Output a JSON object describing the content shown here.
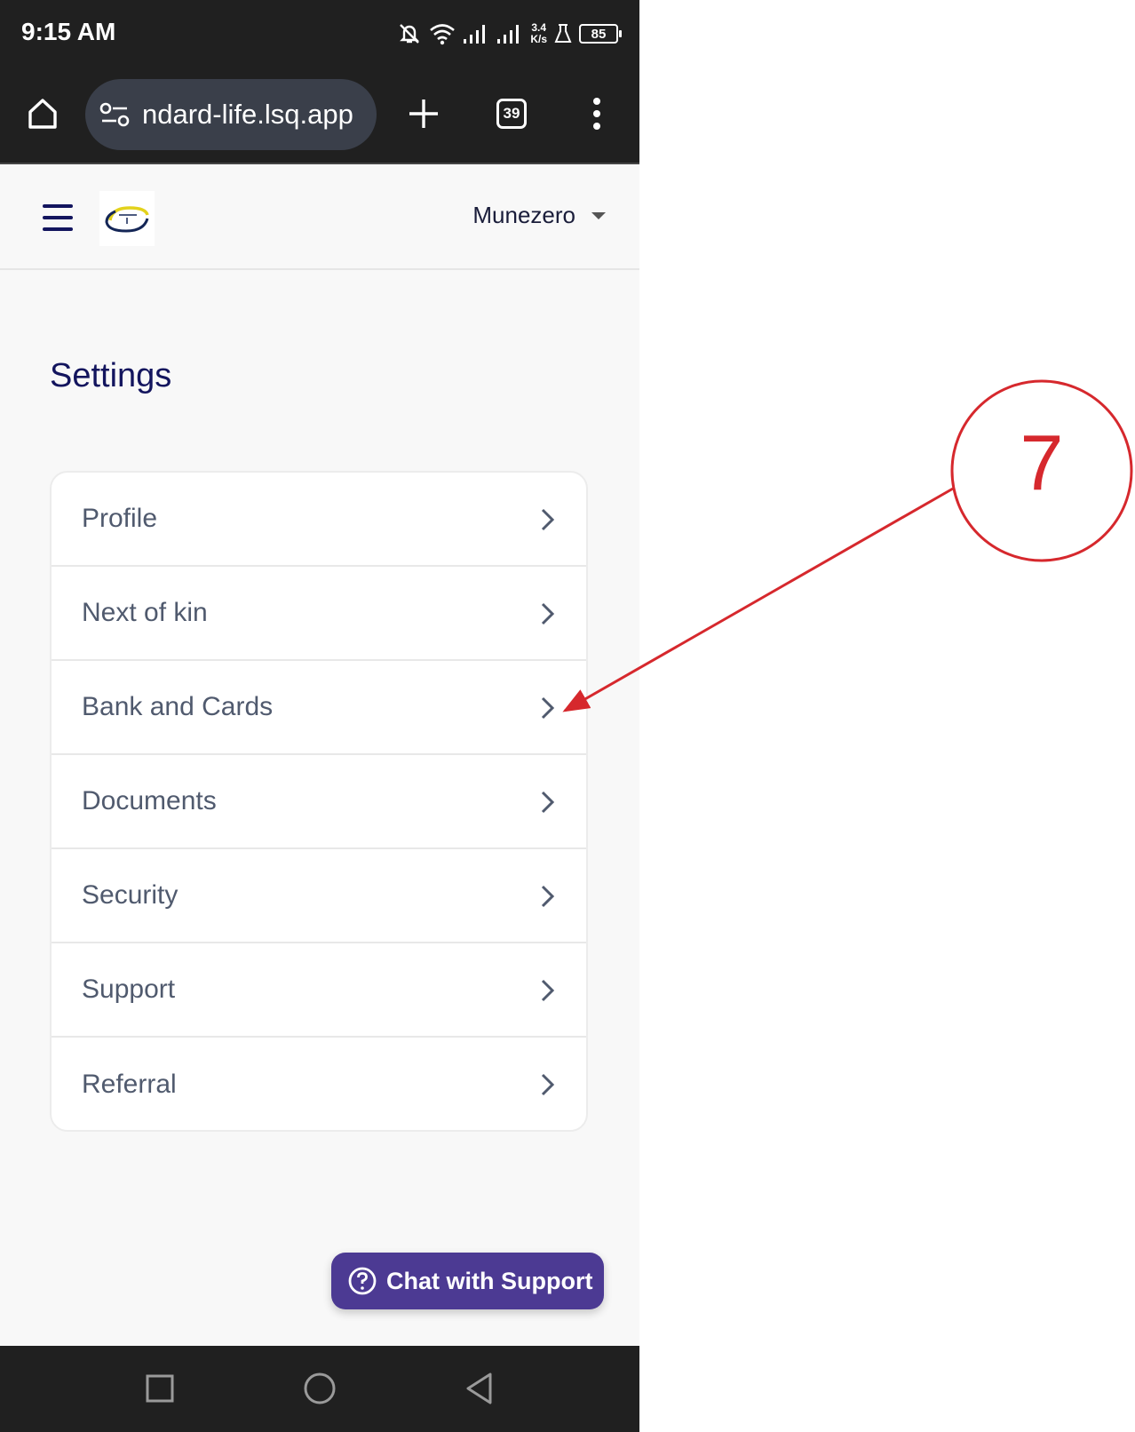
{
  "status_bar": {
    "time": "9:15 AM",
    "net_speed_value": "3.4",
    "net_speed_unit": "K/s",
    "battery": "85"
  },
  "browser": {
    "url": "ndard-life.lsq.app",
    "tab_count": "39",
    "icons": [
      "home-icon",
      "site-settings-icon",
      "new-tab-icon",
      "tab-switcher-icon",
      "more-menu-icon"
    ]
  },
  "header": {
    "user_name": "Munezero",
    "icons": [
      "hamburger-icon",
      "logo",
      "chevron-down-icon"
    ]
  },
  "page": {
    "title": "Settings"
  },
  "settings": {
    "items": [
      {
        "label": "Profile"
      },
      {
        "label": "Next of kin"
      },
      {
        "label": "Bank and Cards"
      },
      {
        "label": "Documents"
      },
      {
        "label": "Security"
      },
      {
        "label": "Support"
      },
      {
        "label": "Referral"
      }
    ]
  },
  "chat": {
    "label": "Chat with Support",
    "icon": "help-circle-icon"
  },
  "annotation": {
    "step_number": "7",
    "color": "#d6282d",
    "target": "Bank and Cards"
  },
  "colors": {
    "title_navy": "#13155e",
    "chat_purple": "#4c3a93",
    "system_bar": "#202020"
  }
}
